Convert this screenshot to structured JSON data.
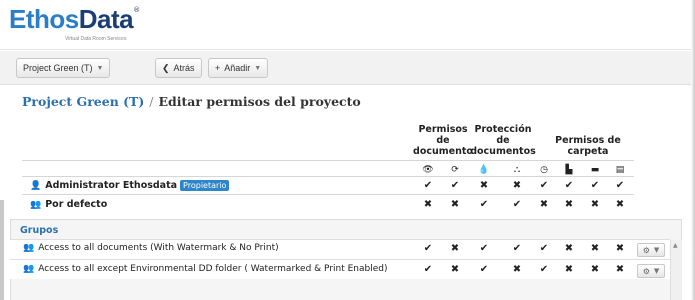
{
  "logo": {
    "brand_part1": "Ethos",
    "brand_part2": "Data",
    "registered": "®",
    "tagline": "Virtual Data Room Services"
  },
  "toolbar": {
    "project_select": "Project Green (T)",
    "back_label": "Atrás",
    "add_label": "Añadir"
  },
  "breadcrumb": {
    "project": "Project Green (T)",
    "separator": "/",
    "current": "Editar permisos del proyecto"
  },
  "column_groups": {
    "document_permissions": [
      "Permisos",
      "de",
      "documento"
    ],
    "document_protection": [
      "Protección",
      "de",
      "documentos"
    ],
    "folder_permissions": [
      "Permisos de",
      "carpeta"
    ]
  },
  "column_icons": [
    "eye-icon",
    "sync-icon",
    "drop-icon",
    "sitemap-icon",
    "clock-icon",
    "file-icon",
    "folder-open-icon",
    "file-text-icon"
  ],
  "users": [
    {
      "name": "Administrator Ethosdata",
      "badge": "Propietario",
      "permissions": [
        "✔",
        "✔",
        "✖",
        "✖",
        "✔",
        "✔",
        "✔",
        "✔"
      ]
    },
    {
      "name": "Por defecto",
      "badge": "",
      "permissions": [
        "✖",
        "✖",
        "✔",
        "✔",
        "✖",
        "✖",
        "✖",
        "✖"
      ]
    }
  ],
  "groups_title": "Grupos",
  "groups": [
    {
      "name": "Access to all documents (With Watermark & No Print)",
      "permissions": [
        "✔",
        "✖",
        "✔",
        "✔",
        "✔",
        "✖",
        "✖",
        "✖"
      ]
    },
    {
      "name": "Access to all except Environmental DD folder ( Watermarked & Print Enabled)",
      "permissions": [
        "✔",
        "✖",
        "✔",
        "✖",
        "✔",
        "✖",
        "✖",
        "✖"
      ]
    }
  ],
  "colors": {
    "brand_blue": "#2a7ec8",
    "brand_navy": "#1c3f73",
    "link": "#2a6fb0",
    "badge": "#2d86c9"
  }
}
